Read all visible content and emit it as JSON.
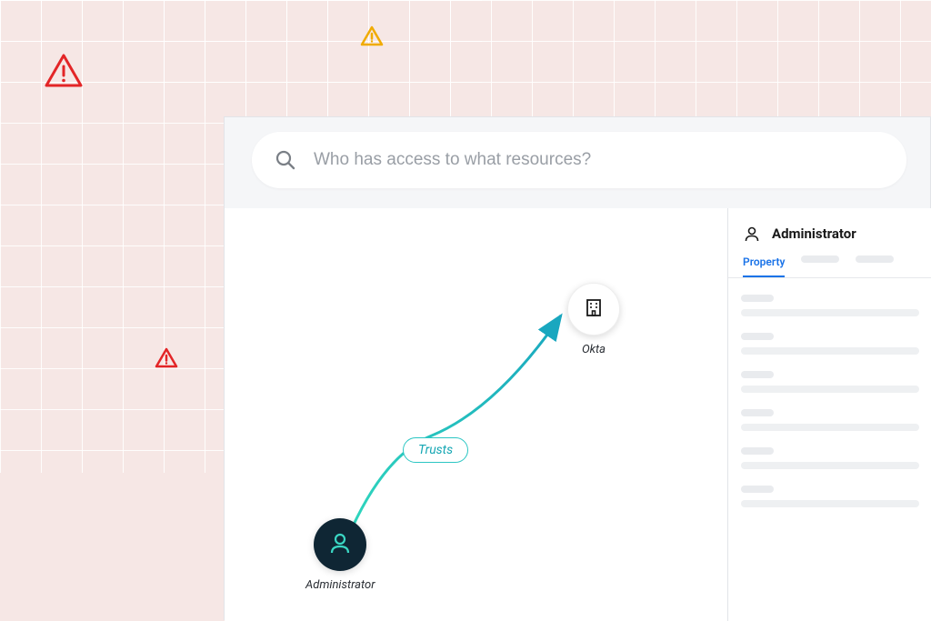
{
  "search": {
    "placeholder": "Who has access to what resources?"
  },
  "graph": {
    "nodes": {
      "admin": {
        "label": "Administrator",
        "icon": "user-icon"
      },
      "okta": {
        "label": "Okta",
        "icon": "building-icon"
      }
    },
    "edge": {
      "label": "Trusts"
    }
  },
  "sidebar": {
    "title": "Administrator",
    "tabs": {
      "property": "Property"
    }
  },
  "colors": {
    "admin_node_bg": "#0f2634",
    "edge_teal": "#2bc6c3",
    "tab_blue": "#1a73e8",
    "alert_red": "#e32527",
    "alert_yellow": "#f0ab00"
  }
}
